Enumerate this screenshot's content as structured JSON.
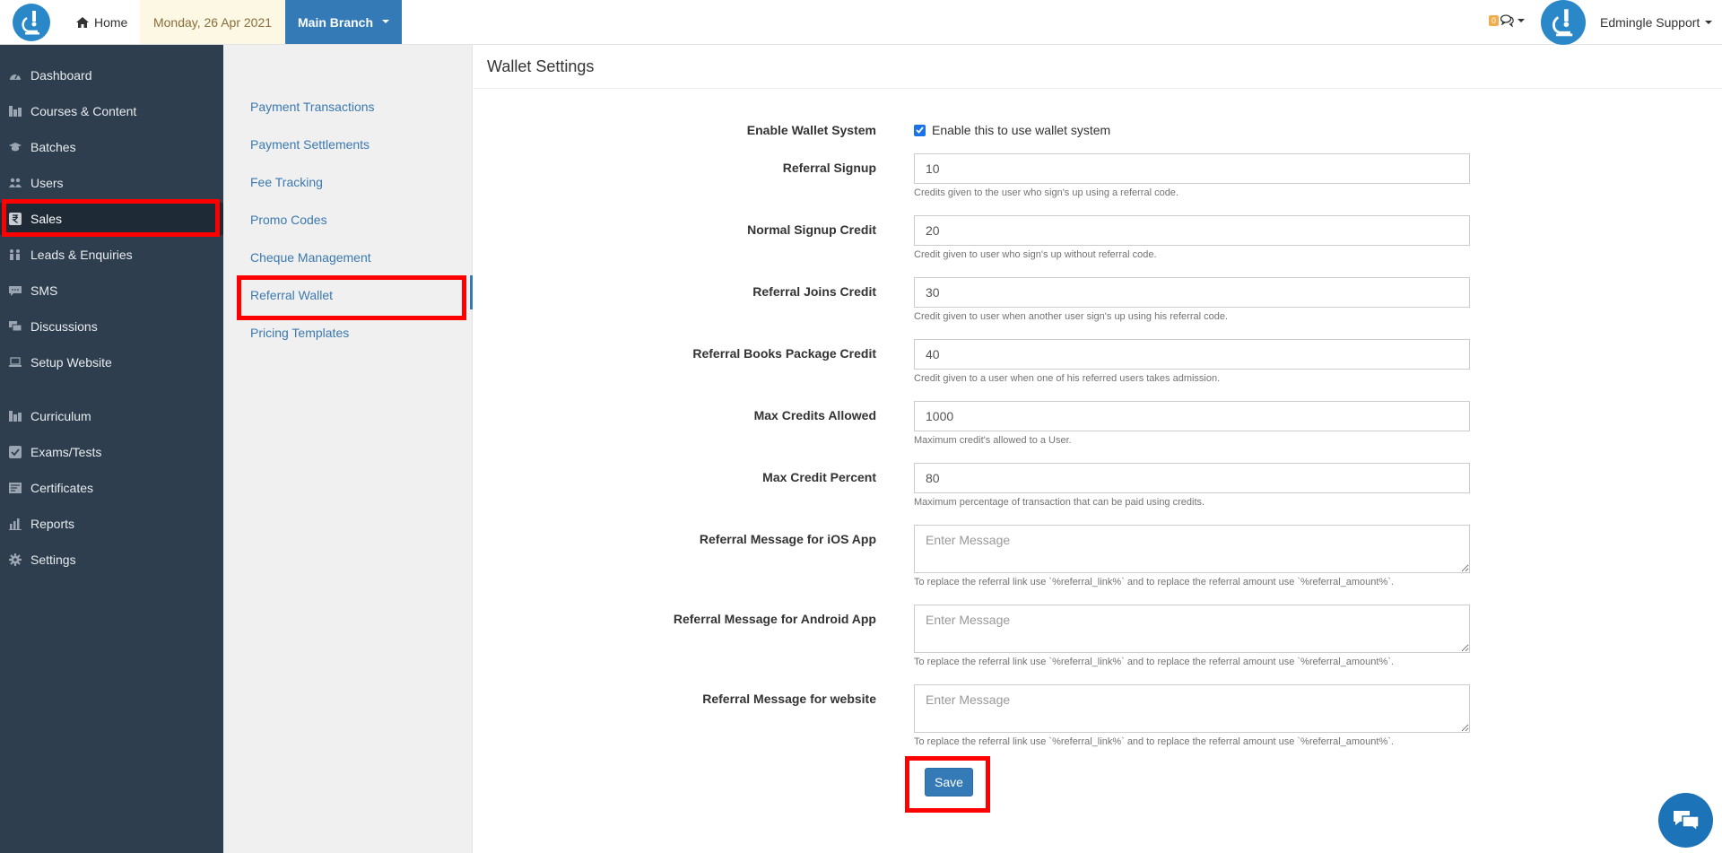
{
  "topbar": {
    "home_label": "Home",
    "date": "Monday, 26 Apr 2021",
    "branch": "Main Branch",
    "notif_count": "0",
    "user_name": "Edmingle Support"
  },
  "sidebar": {
    "items": [
      {
        "label": "Dashboard",
        "icon": "dashboard-icon"
      },
      {
        "label": "Courses & Content",
        "icon": "courses-icon"
      },
      {
        "label": "Batches",
        "icon": "batches-icon"
      },
      {
        "label": "Users",
        "icon": "users-icon"
      },
      {
        "label": "Sales",
        "icon": "rupee-icon"
      },
      {
        "label": "Leads & Enquiries",
        "icon": "leads-icon"
      },
      {
        "label": "SMS",
        "icon": "sms-icon"
      },
      {
        "label": "Discussions",
        "icon": "discussions-icon"
      },
      {
        "label": "Setup Website",
        "icon": "laptop-icon"
      },
      {
        "label": "Curriculum",
        "icon": "curriculum-icon"
      },
      {
        "label": "Exams/Tests",
        "icon": "check-square-icon"
      },
      {
        "label": "Certificates",
        "icon": "certificate-icon"
      },
      {
        "label": "Reports",
        "icon": "bar-chart-icon"
      },
      {
        "label": "Settings",
        "icon": "gear-icon"
      }
    ],
    "active": "Sales"
  },
  "submenu": {
    "items": [
      "Payment Transactions",
      "Payment Settlements",
      "Fee Tracking",
      "Promo Codes",
      "Cheque Management",
      "Referral Wallet",
      "Pricing Templates"
    ],
    "active": "Referral Wallet"
  },
  "main": {
    "title": "Wallet Settings",
    "enable_wallet": {
      "label": "Enable Wallet System",
      "checkbox_text": "Enable this to use wallet system",
      "checked": true
    },
    "fields": [
      {
        "label": "Referral Signup",
        "value": "10",
        "help": "Credits given to the user who sign's up using a referral code."
      },
      {
        "label": "Normal Signup Credit",
        "value": "20",
        "help": "Credit given to user who sign's up without referral code."
      },
      {
        "label": "Referral Joins Credit",
        "value": "30",
        "help": "Credit given to user when another user sign's up using his referral code."
      },
      {
        "label": "Referral Books Package Credit",
        "value": "40",
        "help": "Credit given to a user when one of his referred users takes admission."
      },
      {
        "label": "Max Credits Allowed",
        "value": "1000",
        "help": "Maximum credit's allowed to a User."
      },
      {
        "label": "Max Credit Percent",
        "value": "80",
        "help": "Maximum percentage of transaction that can be paid using credits."
      }
    ],
    "messages": [
      {
        "label": "Referral Message for iOS App",
        "placeholder": "Enter Message",
        "help": "To replace the referral link use `%referral_link%` and to replace the referral amount use `%referral_amount%`."
      },
      {
        "label": "Referral Message for Android App",
        "placeholder": "Enter Message",
        "help": "To replace the referral link use `%referral_link%` and to replace the referral amount use `%referral_amount%`."
      },
      {
        "label": "Referral Message for website",
        "placeholder": "Enter Message",
        "help": "To replace the referral link use `%referral_link%` and to replace the referral amount use `%referral_amount%`."
      }
    ],
    "save_label": "Save"
  },
  "colors": {
    "sidebar_bg": "#2e3e4e",
    "accent": "#337ab7",
    "highlight": "#ff0000"
  }
}
